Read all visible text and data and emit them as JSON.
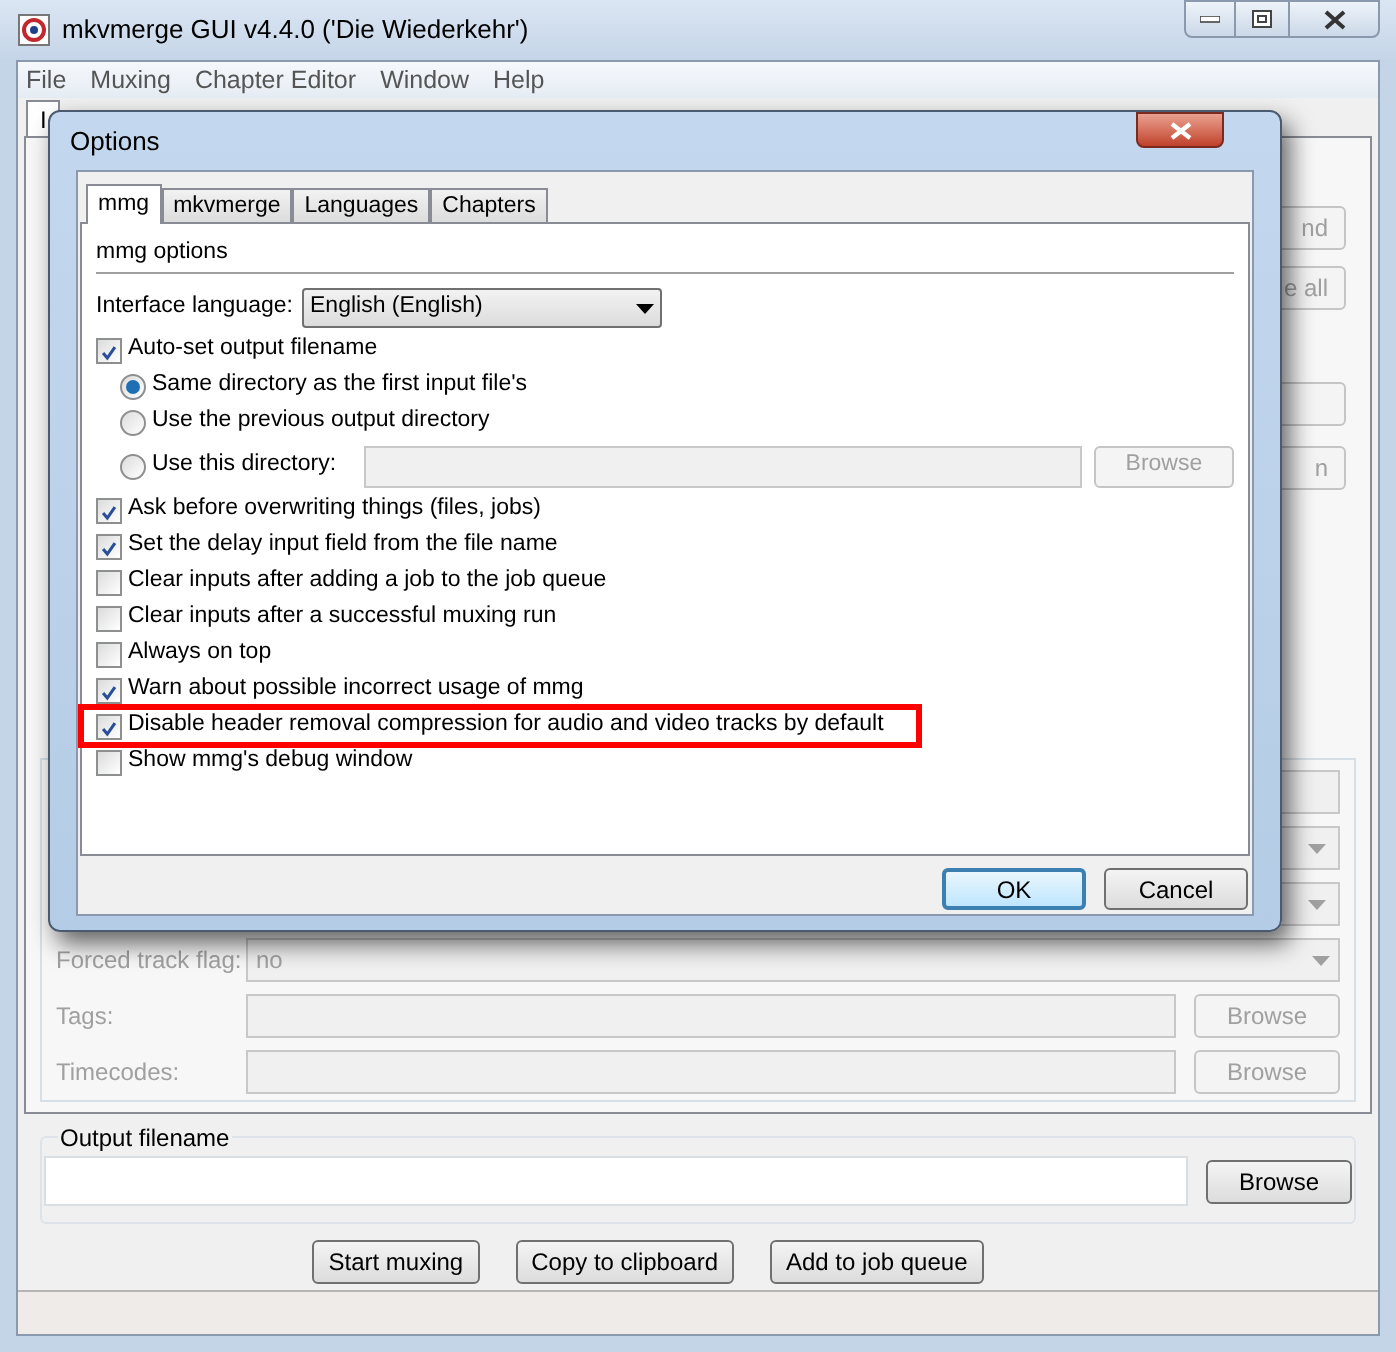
{
  "window": {
    "title": "mkvmerge GUI v4.4.0 ('Die Wiederkehr')"
  },
  "menu": [
    "File",
    "Muxing",
    "Chapter Editor",
    "Window",
    "Help"
  ],
  "main_tabs": [
    {
      "label": "I",
      "selected": true
    }
  ],
  "side_buttons_top": [
    "nd",
    "e all"
  ],
  "side_buttons_bottom": [
    "n"
  ],
  "covered_rows": [
    {
      "kind": "field"
    },
    {
      "kind": "dropdown"
    },
    {
      "kind": "dropdown"
    }
  ],
  "track_options": [
    {
      "label": "Forced track flag:",
      "kind": "dropdown",
      "value": "no",
      "disabled": true
    },
    {
      "label": "Tags:",
      "kind": "file",
      "button": "Browse",
      "disabled": true
    },
    {
      "label": "Timecodes:",
      "kind": "file",
      "button": "Browse",
      "disabled": true
    }
  ],
  "output": {
    "label": "Output filename",
    "button": "Browse"
  },
  "actions": [
    "Start muxing",
    "Copy to clipboard",
    "Add to job queue"
  ],
  "dialog": {
    "title": "Options",
    "tabs": [
      {
        "label": "mmg",
        "selected": true
      },
      {
        "label": "mkvmerge",
        "selected": false
      },
      {
        "label": "Languages",
        "selected": false
      },
      {
        "label": "Chapters",
        "selected": false
      }
    ],
    "section": "mmg options",
    "language": {
      "label": "Interface language:",
      "value": "English (English)"
    },
    "options": [
      {
        "kind": "checkbox",
        "label": "Auto-set output filename",
        "checked": true
      },
      {
        "kind": "radio",
        "label": "Same directory as the first input file's",
        "selected": true
      },
      {
        "kind": "radio",
        "label": "Use the previous output directory",
        "selected": false
      },
      {
        "kind": "radio-dir",
        "label": "Use this directory:",
        "selected": false,
        "button": "Browse"
      },
      {
        "kind": "checkbox",
        "label": "Ask before overwriting things (files, jobs)",
        "checked": true
      },
      {
        "kind": "checkbox",
        "label": "Set the delay input field from the file name",
        "checked": true
      },
      {
        "kind": "checkbox",
        "label": "Clear inputs after adding a job to the job queue",
        "checked": false
      },
      {
        "kind": "checkbox",
        "label": "Clear inputs after a successful muxing run",
        "checked": false
      },
      {
        "kind": "checkbox",
        "label": "Always on top",
        "checked": false
      },
      {
        "kind": "checkbox",
        "label": "Warn about possible incorrect usage of mmg",
        "checked": true
      },
      {
        "kind": "checkbox",
        "label": "Disable header removal compression for audio and video tracks by default",
        "checked": true,
        "highlighted": true
      },
      {
        "kind": "checkbox",
        "label": "Show mmg's debug window",
        "checked": false
      }
    ],
    "buttons": [
      {
        "label": "OK",
        "default": true
      },
      {
        "label": "Cancel",
        "default": false
      }
    ]
  }
}
